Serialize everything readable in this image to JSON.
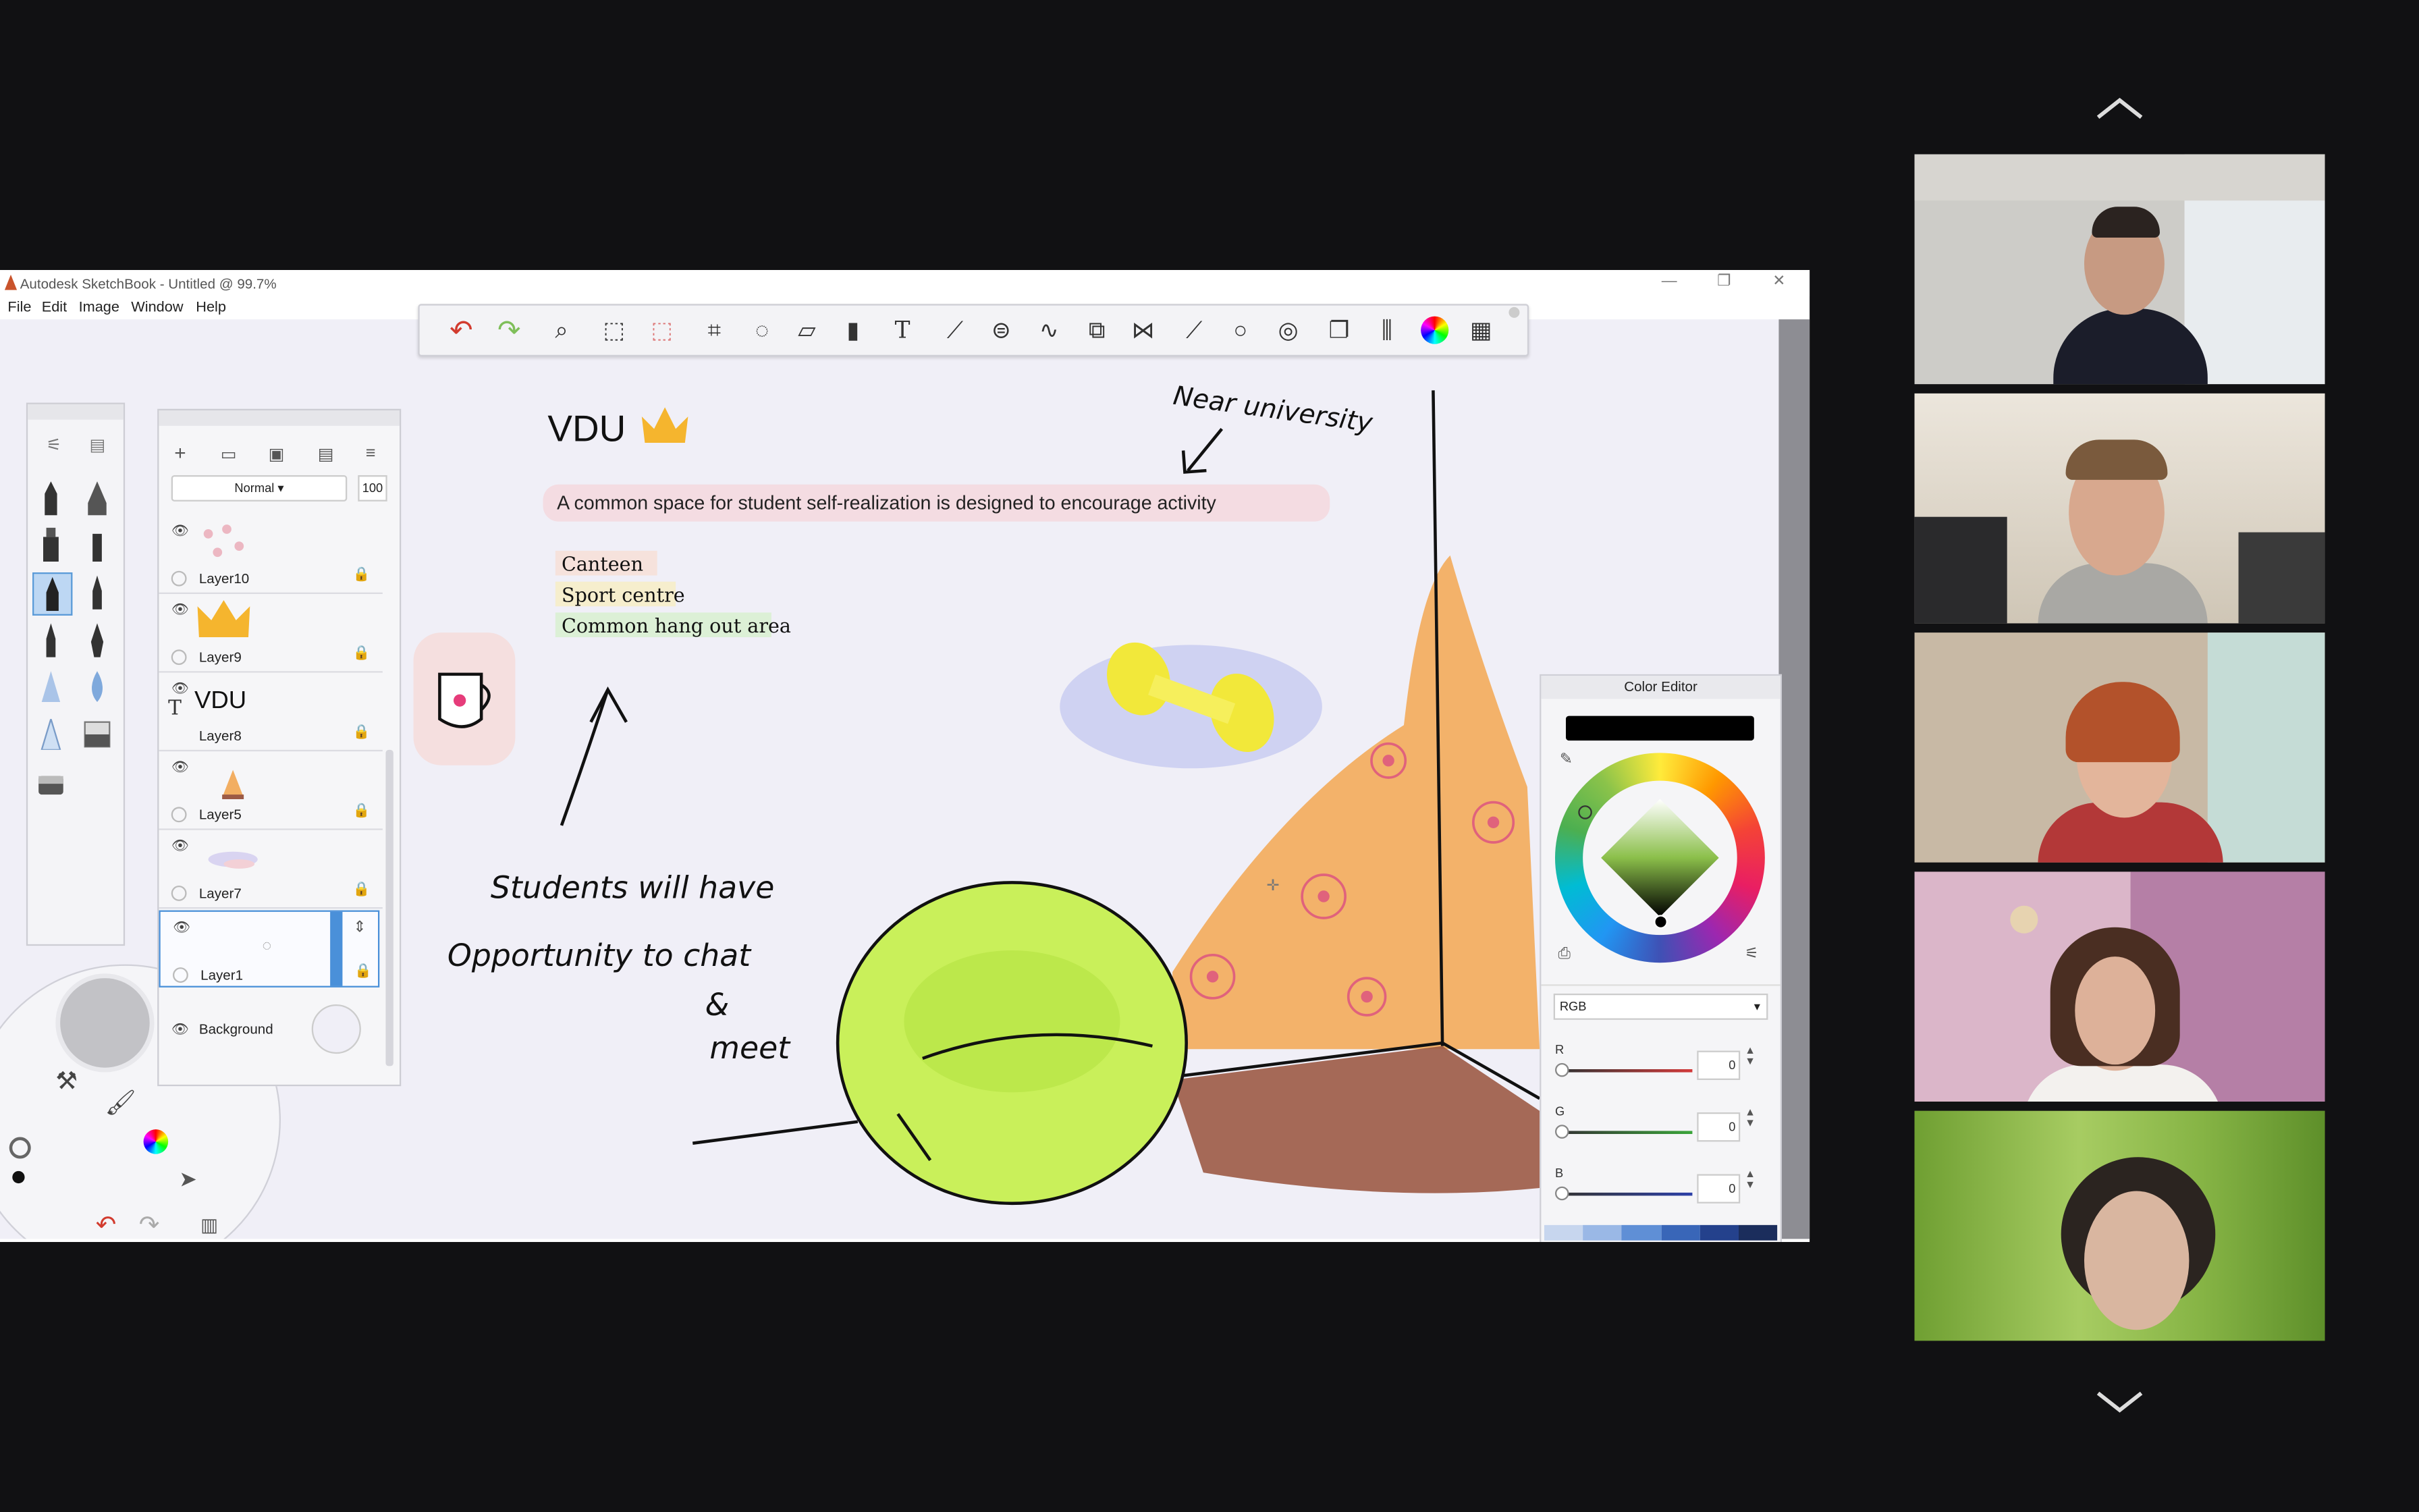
{
  "window": {
    "title": "Autodesk SketchBook - Untitled @ 99.7%",
    "controls": {
      "minimize": "—",
      "restore": "❐",
      "close": "✕"
    }
  },
  "menu": [
    "File",
    "Edit",
    "Image",
    "Window",
    "Help"
  ],
  "toolbar": {
    "icons": [
      "undo-icon",
      "redo-icon",
      "zoom-icon",
      "select-icon",
      "transform-select-icon",
      "crop-icon",
      "lasso-icon",
      "distort-icon",
      "fill-icon",
      "text-icon",
      "ruler-icon",
      "ellipse-guide-icon",
      "french-curve-icon",
      "perspective-icon",
      "symmetry-icon",
      "stroke-icon",
      "ellipse-icon",
      "shapes-icon",
      "copy-icon",
      "brush-library-icon",
      "color-wheel-icon",
      "palette-icon"
    ]
  },
  "layers_panel": {
    "blend_mode": "Normal",
    "opacity": "100",
    "layers": [
      {
        "name": "Layer10",
        "thumb": "flowers"
      },
      {
        "name": "Layer9",
        "thumb": "crown"
      },
      {
        "name": "Layer8",
        "thumb": "text",
        "thumb_text": "VDU"
      },
      {
        "name": "Layer5",
        "thumb": "cone"
      },
      {
        "name": "Layer7",
        "thumb": "smudge"
      },
      {
        "name": "Layer1",
        "thumb": "empty",
        "selected": true
      }
    ],
    "background_label": "Background"
  },
  "canvas": {
    "heading": "VDU",
    "tagline": "A common space for student self-realization is designed to encourage activity",
    "list": [
      "Canteen",
      "Sport centre",
      "Common hang out area"
    ],
    "note_near": "Near university",
    "note_students": [
      "Students will have",
      "Opportunity to chat",
      "&",
      "meet"
    ]
  },
  "color_editor": {
    "title": "Color Editor",
    "current_color": "#000000",
    "mode": "RGB",
    "channels": [
      {
        "label": "R",
        "value": "0",
        "color": "#d33a3a"
      },
      {
        "label": "G",
        "value": "0",
        "color": "#3aa53a"
      },
      {
        "label": "B",
        "value": "0",
        "color": "#2c3fa8"
      }
    ],
    "swatches": [
      "#c7d6ee",
      "#9ab8e6",
      "#5f8fd6",
      "#3966b8",
      "#24418c",
      "#1b2d5c"
    ]
  },
  "participants": [
    {
      "name": "participant-1",
      "bg": "#c9c6c0"
    },
    {
      "name": "participant-2",
      "bg": "#d8d2c6"
    },
    {
      "name": "participant-3",
      "bg": "#cfc3b3"
    },
    {
      "name": "participant-4",
      "bg": "#d8b2c6"
    },
    {
      "name": "participant-5",
      "bg": "#7daa3f"
    }
  ],
  "navigation": {
    "up": "scroll-up",
    "down": "scroll-down"
  }
}
